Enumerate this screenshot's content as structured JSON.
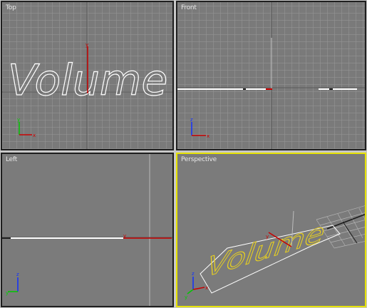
{
  "viewports": [
    {
      "id": "top",
      "label": "Top",
      "active": false,
      "shape_text": "Volume"
    },
    {
      "id": "front",
      "label": "Front",
      "active": false
    },
    {
      "id": "left",
      "label": "Left",
      "active": false
    },
    {
      "id": "perspective",
      "label": "Perspective",
      "active": true,
      "shape_text": "Volume"
    }
  ],
  "axis_labels": {
    "x": "x",
    "y": "y",
    "z": "z"
  },
  "colors": {
    "viewport_bg": "#7a7a7a",
    "grid": "#969696",
    "active_border": "#e7e300",
    "inactive_border": "#1e1e1e",
    "axis_x": "#c80000",
    "axis_y": "#00c800",
    "axis_z": "#1030ff",
    "spline_shape": "#ffffff",
    "selected_shape": "#e8d020"
  }
}
